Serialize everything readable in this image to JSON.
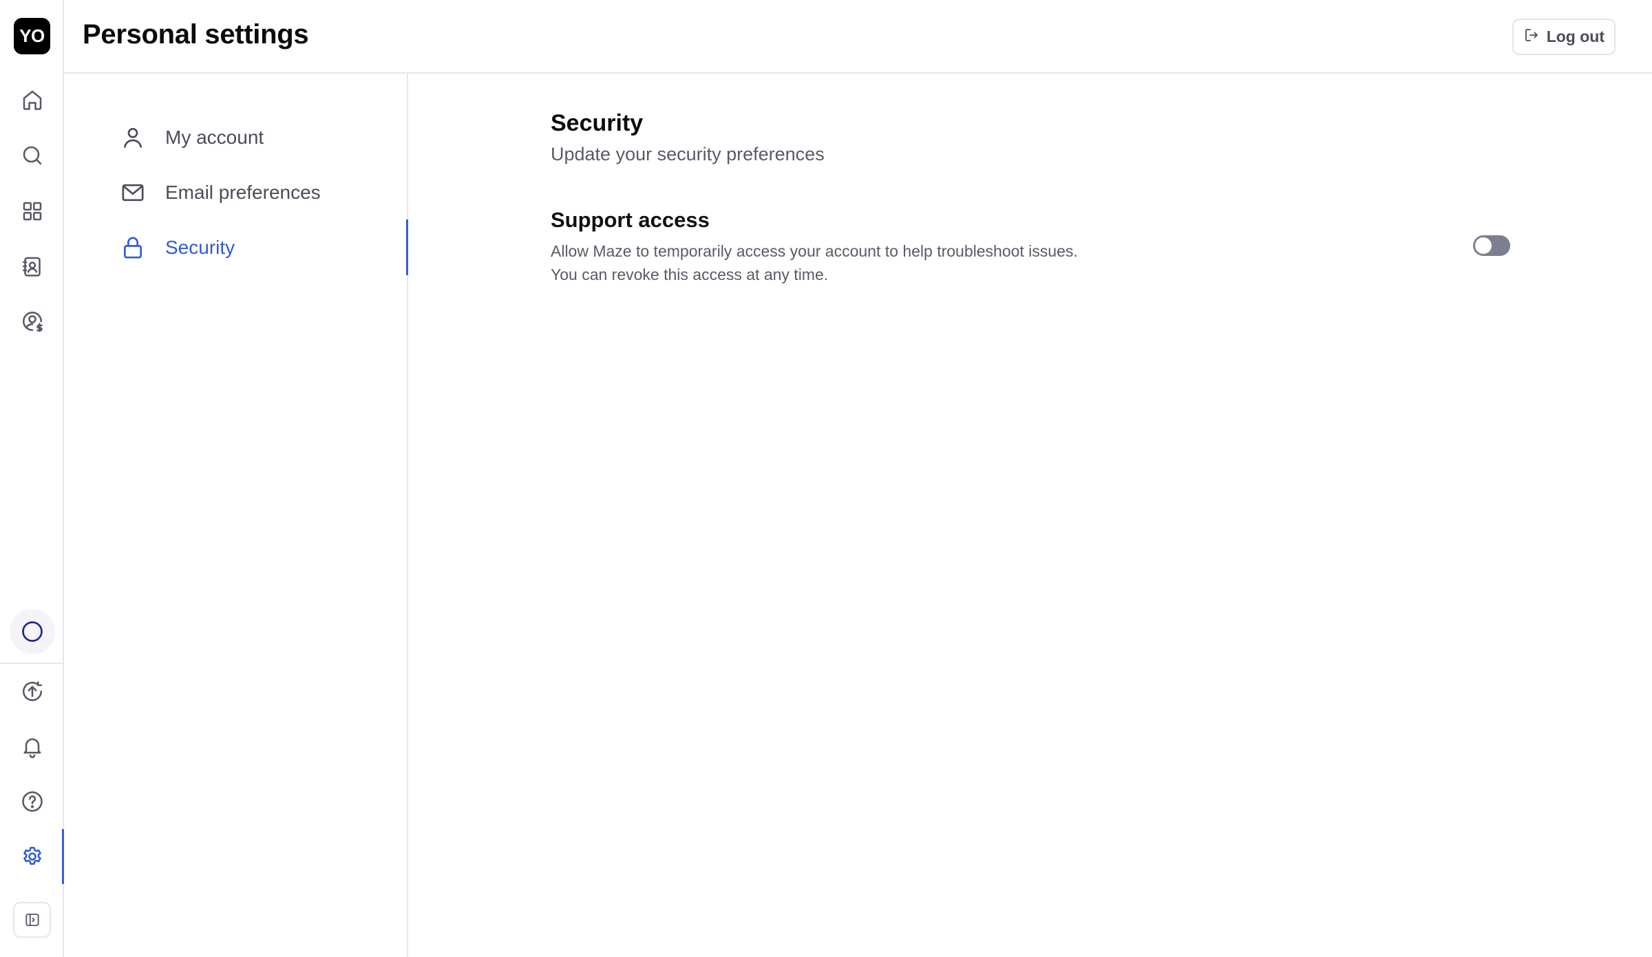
{
  "user": {
    "initials": "YO"
  },
  "header": {
    "title": "Personal settings",
    "logout_label": "Log out"
  },
  "rail": {
    "top_items": [
      {
        "name": "home",
        "icon": "home-icon"
      },
      {
        "name": "search",
        "icon": "search-icon"
      },
      {
        "name": "apps",
        "icon": "grid-icon"
      },
      {
        "name": "contacts",
        "icon": "contact-book-icon"
      },
      {
        "name": "billing",
        "icon": "user-dollar-icon"
      }
    ],
    "status_icon": "circle-icon",
    "bottom_items": [
      {
        "name": "upload",
        "icon": "upload-circle-icon"
      },
      {
        "name": "notifications",
        "icon": "bell-icon"
      },
      {
        "name": "help",
        "icon": "help-icon"
      },
      {
        "name": "settings",
        "icon": "gear-icon",
        "active": true
      }
    ],
    "collapse_icon": "sidebar-toggle-icon"
  },
  "settings_nav": {
    "items": [
      {
        "label": "My account",
        "icon": "user-icon",
        "active": false
      },
      {
        "label": "Email preferences",
        "icon": "mail-icon",
        "active": false
      },
      {
        "label": "Security",
        "icon": "lock-icon",
        "active": true
      }
    ]
  },
  "main": {
    "title": "Security",
    "subtitle": "Update your security preferences",
    "support_access": {
      "title": "Support access",
      "description_line1": "Allow Maze to temporarily access your account to help troubleshoot issues.",
      "description_line2": "You can revoke this access at any time.",
      "enabled": false
    }
  },
  "colors": {
    "accent": "#3b5bdb",
    "active_text": "#2f5bd6",
    "muted_text": "#585b66",
    "border": "#e6e7eb",
    "toggle_off": "#7b7f8f"
  }
}
